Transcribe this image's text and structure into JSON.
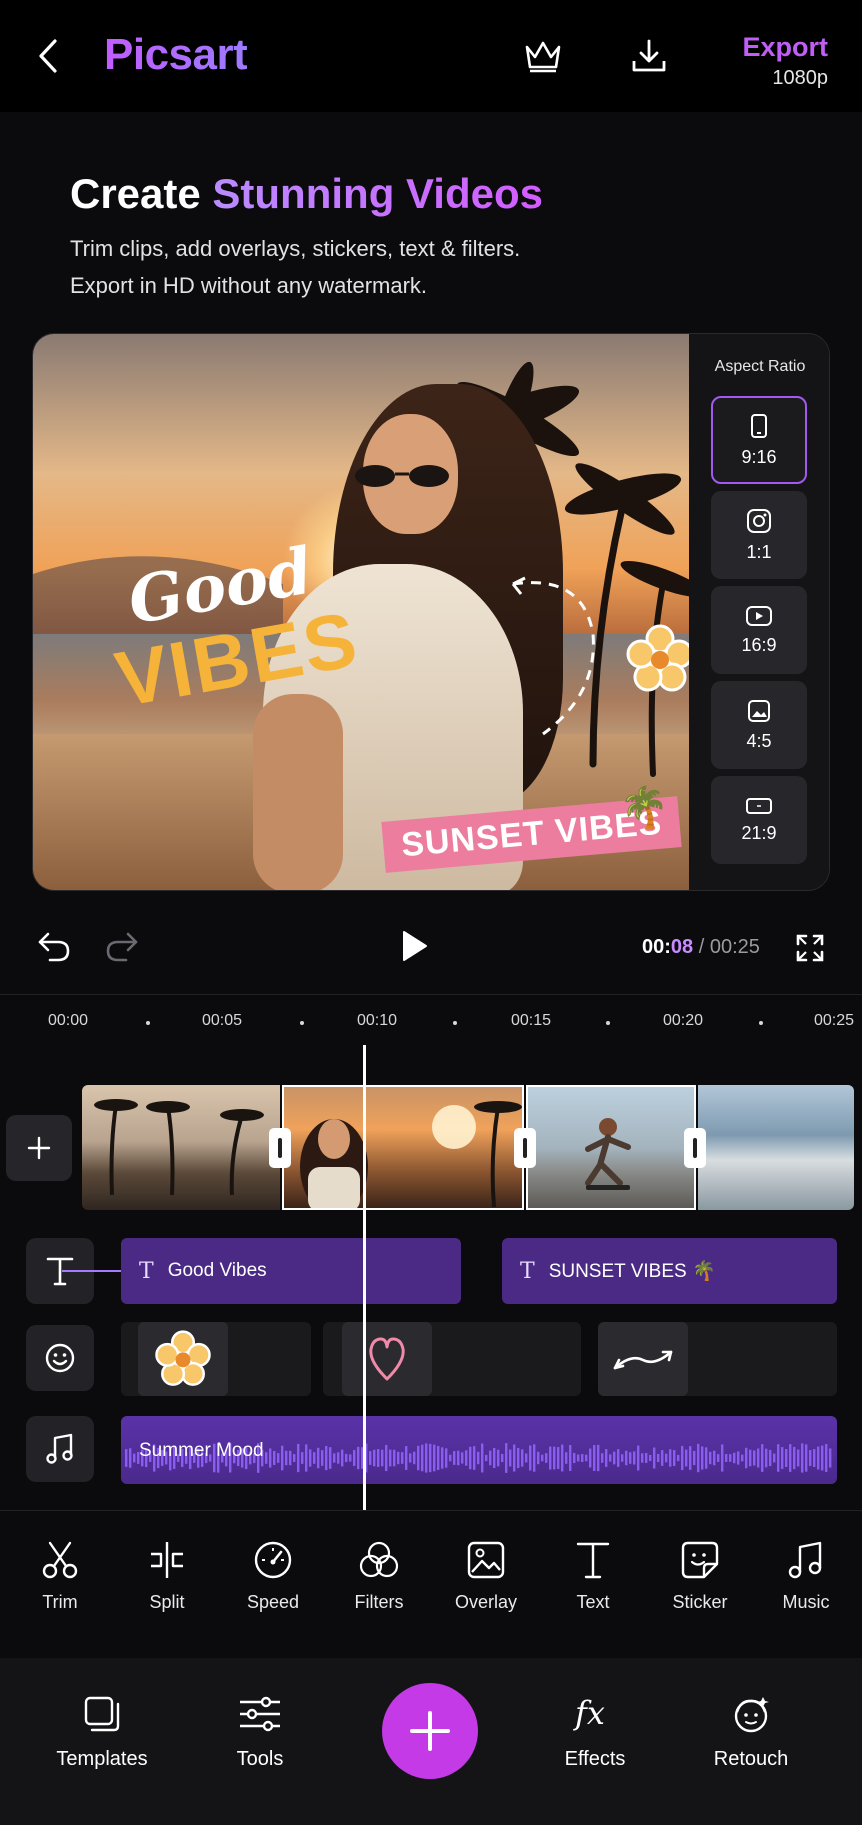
{
  "header": {
    "brand": "Picsart",
    "export_label": "Export",
    "export_resolution": "1080p"
  },
  "hero": {
    "title_plain": "Create ",
    "title_accent": "Stunning Videos",
    "subtitle_line1": "Trim clips, add overlays, stickers, text & filters.",
    "subtitle_line2": "Export in HD without any watermark."
  },
  "preview": {
    "overlay_good": "Good",
    "overlay_vibes": "VIBES",
    "overlay_sunset": "SUNSET VIBES"
  },
  "aspect": {
    "title": "Aspect Ratio",
    "options": [
      {
        "label": "9:16",
        "icon": "phone-icon"
      },
      {
        "label": "1:1",
        "icon": "instagram-icon"
      },
      {
        "label": "16:9",
        "icon": "youtube-icon"
      },
      {
        "label": "4:5",
        "icon": "image-icon"
      },
      {
        "label": "21:9",
        "icon": "widescreen-icon"
      }
    ],
    "selected": "9:16"
  },
  "playback": {
    "current_min": "00:",
    "current_sec": "08",
    "separator": " / ",
    "total": "00:25"
  },
  "ruler": {
    "ticks": [
      "00:00",
      "00:05",
      "00:10",
      "00:15",
      "00:20",
      "00:25"
    ]
  },
  "tracks": {
    "text_clips": [
      "Good Vibes",
      "SUNSET VIBES 🌴"
    ],
    "audio_label": "Summer Mood"
  },
  "tools": [
    "Trim",
    "Split",
    "Speed",
    "Filters",
    "Overlay",
    "Text",
    "Sticker",
    "Music"
  ],
  "nav": {
    "templates": "Templates",
    "tools": "Tools",
    "effects": "Effects",
    "retouch": "Retouch"
  },
  "colors": {
    "accent": "#c15ef5",
    "fab": "#c33ae6",
    "text_clip": "#4a2a84",
    "audio_clip": "#5a32a8"
  }
}
